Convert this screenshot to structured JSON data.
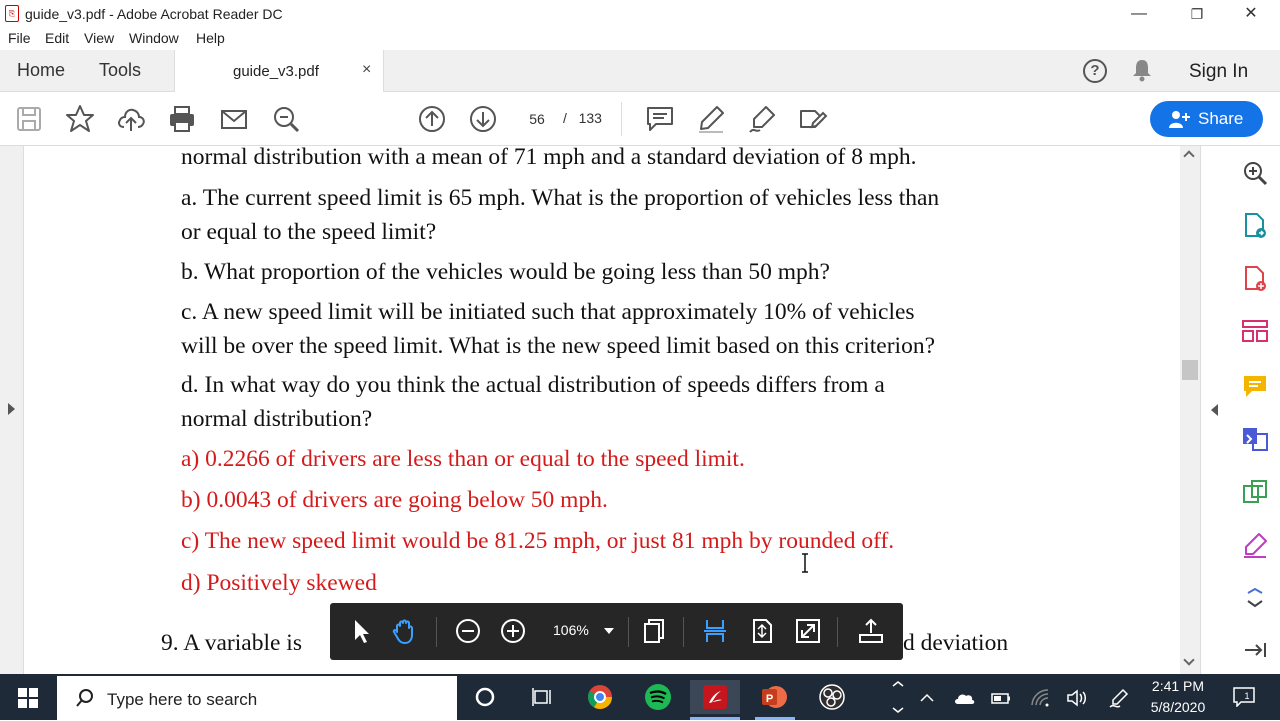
{
  "window": {
    "title": "guide_v3.pdf - Adobe Acrobat Reader DC",
    "minimize": "—",
    "maximize": "❐",
    "close": "✕"
  },
  "menu": [
    "File",
    "Edit",
    "View",
    "Window",
    "Help"
  ],
  "tabs": {
    "home": "Home",
    "tools": "Tools",
    "document": "guide_v3.pdf",
    "close": "×",
    "help": "?",
    "sign_in": "Sign In"
  },
  "toolbar": {
    "current_page": "56",
    "page_separator": "/",
    "total_pages": "133",
    "share_label": "Share"
  },
  "document": {
    "lines": [
      "normal distribution with a mean of 71 mph and a standard deviation of 8 mph.",
      "a. The current speed limit is 65 mph. What is the proportion of vehicles less than",
      "or equal to the speed limit?",
      "b. What proportion of the vehicles would be going less than 50 mph?",
      "c. A new speed limit will be initiated such that approximately 10% of vehicles",
      "will be over the speed limit. What is the new speed limit based on this criterion?",
      "d. In what way do you think the actual distribution of speeds differs from a",
      "normal distribution?"
    ],
    "answers": [
      "a) 0.2266 of drivers are less than or equal to the speed limit.",
      "b) 0.0043 of drivers are going below 50 mph.",
      "c) The new speed limit would be 81.25 mph, or just 81 mph by rounded off.",
      "d) Positively skewed"
    ],
    "next_question_left": "9. A variable is ",
    "next_question_right": "d deviation",
    "text_color": "#111111",
    "answer_color": "#d41a1a"
  },
  "floating_toolbar": {
    "zoom": "106%"
  },
  "taskbar": {
    "search_placeholder": "Type here to search",
    "time": "2:41 PM",
    "date": "5/8/2020",
    "notification_count": "1"
  },
  "colors": {
    "share_button": "#1473e6",
    "taskbar": "#1f2a38",
    "floating_toolbar": "#262626"
  }
}
